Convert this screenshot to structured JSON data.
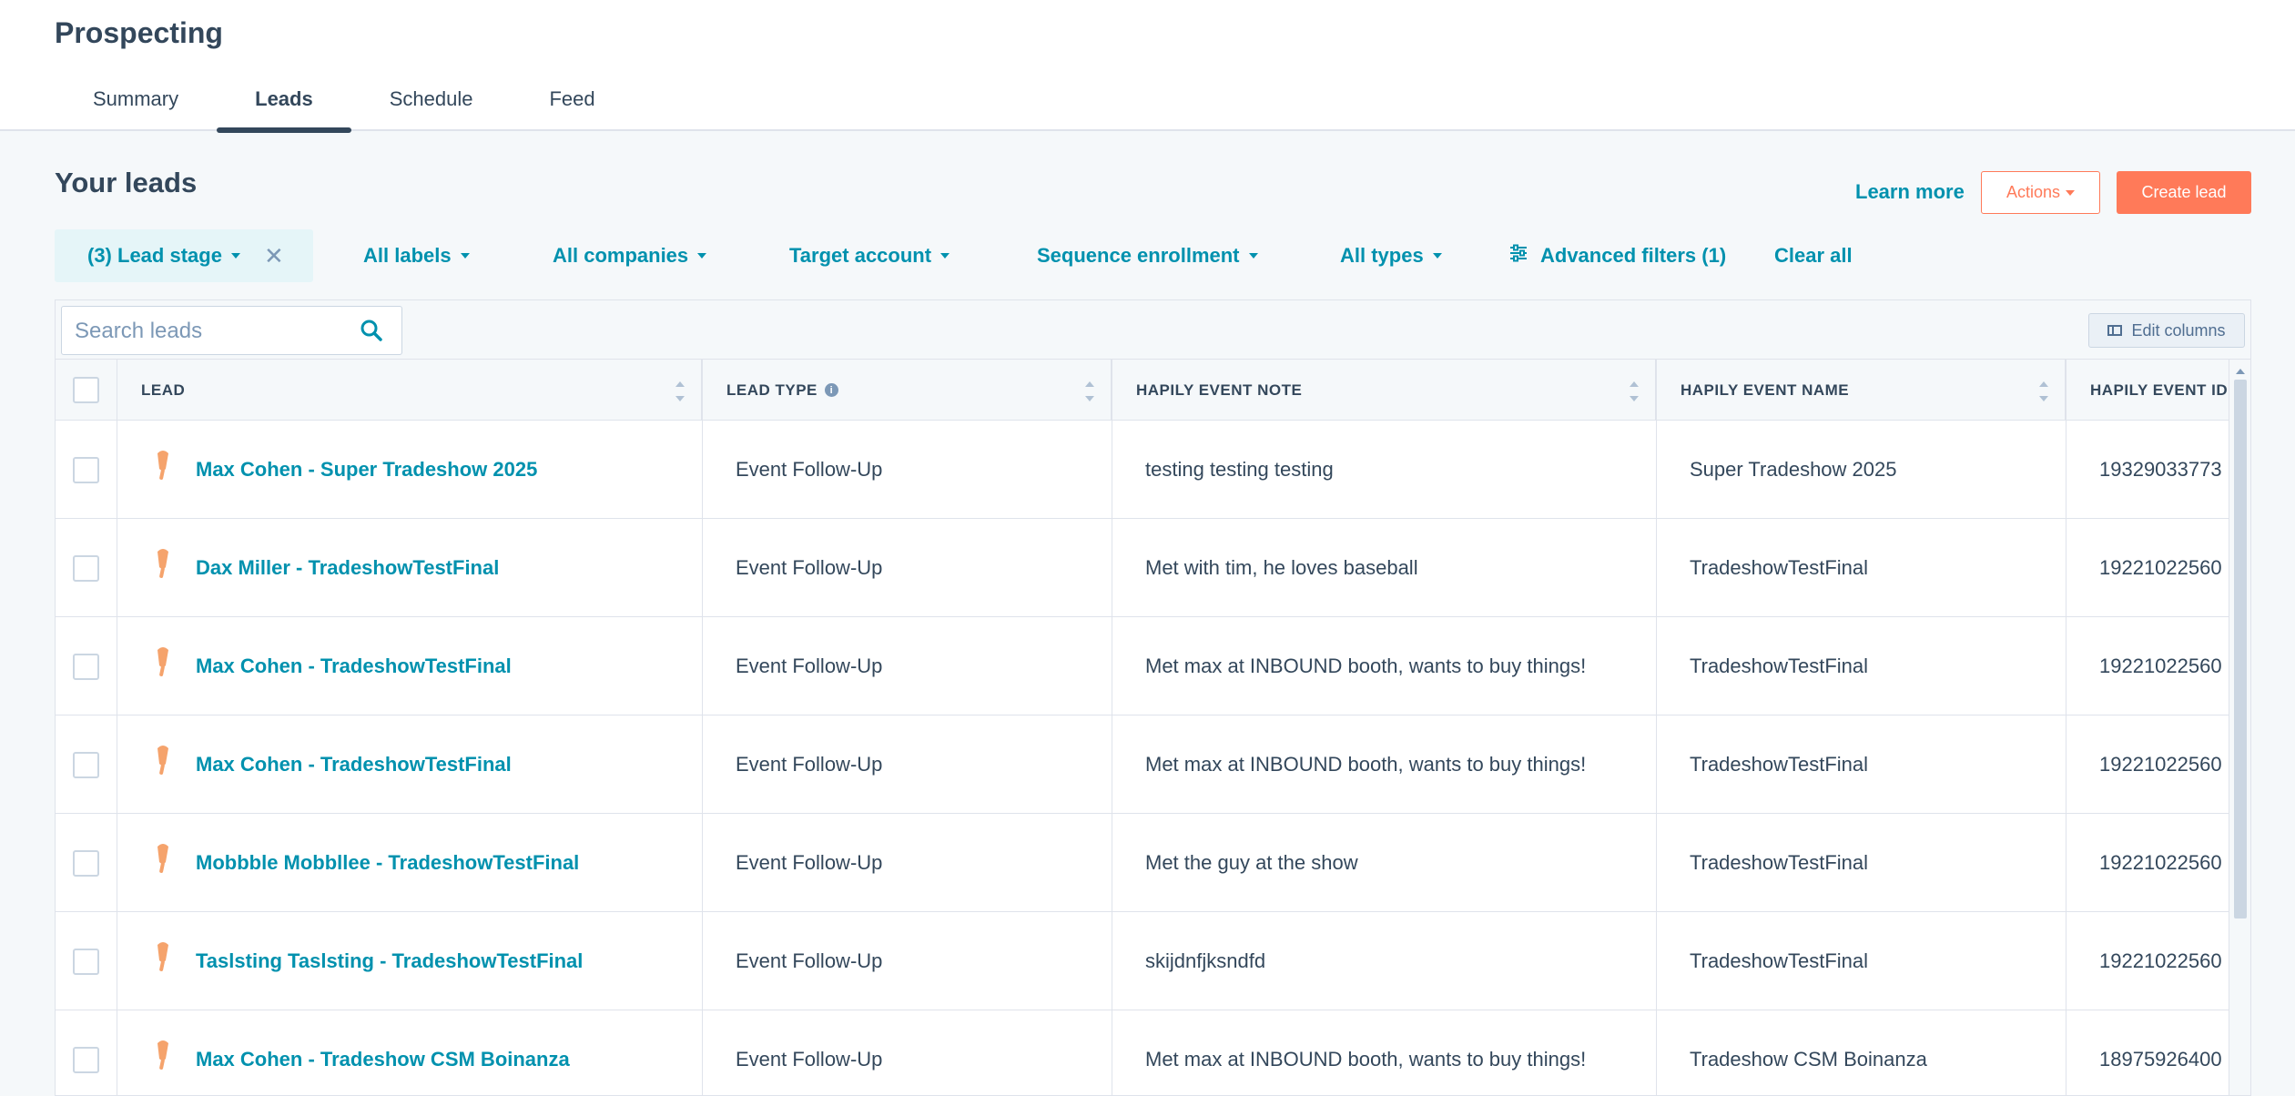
{
  "app": {
    "title": "Prospecting"
  },
  "tabs": [
    {
      "label": "Summary"
    },
    {
      "label": "Leads",
      "active": true
    },
    {
      "label": "Schedule"
    },
    {
      "label": "Feed"
    }
  ],
  "section": {
    "title": "Your leads",
    "learn_more": "Learn more",
    "actions_label": "Actions",
    "create_label": "Create lead"
  },
  "filters": {
    "lead_stage": "(3) Lead stage",
    "labels": "All labels",
    "companies": "All companies",
    "target_account": "Target account",
    "sequence": "Sequence enrollment",
    "types": "All types",
    "advanced": "Advanced filters (1)",
    "clear": "Clear all"
  },
  "search": {
    "placeholder": "Search leads"
  },
  "edit_columns": "Edit columns",
  "columns": {
    "lead": "LEAD",
    "lead_type": "LEAD TYPE",
    "event_note": "HAPILY EVENT NOTE",
    "event_name": "HAPILY EVENT NAME",
    "event_id": "HAPILY EVENT ID"
  },
  "rows": [
    {
      "lead": "Max Cohen - Super Tradeshow 2025",
      "type": "Event Follow-Up",
      "note": "testing testing testing",
      "event": "Super Tradeshow 2025",
      "id": "19329033773"
    },
    {
      "lead": "Dax Miller - TradeshowTestFinal",
      "type": "Event Follow-Up",
      "note": "Met with tim, he loves baseball",
      "event": "TradeshowTestFinal",
      "id": "19221022560"
    },
    {
      "lead": "Max Cohen - TradeshowTestFinal",
      "type": "Event Follow-Up",
      "note": "Met max at INBOUND booth, wants to buy things!",
      "event": "TradeshowTestFinal",
      "id": "19221022560"
    },
    {
      "lead": "Max Cohen - TradeshowTestFinal",
      "type": "Event Follow-Up",
      "note": "Met max at INBOUND booth, wants to buy things!",
      "event": "TradeshowTestFinal",
      "id": "19221022560"
    },
    {
      "lead": "Mobbble Mobbllee - TradeshowTestFinal",
      "type": "Event Follow-Up",
      "note": "Met the guy at the show",
      "event": "TradeshowTestFinal",
      "id": "19221022560"
    },
    {
      "lead": "Taslsting Taslsting - TradeshowTestFinal",
      "type": "Event Follow-Up",
      "note": "skijdnfjksndfd",
      "event": "TradeshowTestFinal",
      "id": "19221022560"
    },
    {
      "lead": "Max Cohen - Tradeshow CSM Boinanza",
      "type": "Event Follow-Up",
      "note": "Met max at INBOUND booth, wants to buy things!",
      "event": "Tradeshow CSM Boinanza",
      "id": "18975926400"
    }
  ],
  "colors": {
    "accent": "#0091ae",
    "primary_button": "#ff7a59",
    "text": "#33475b",
    "lead_icon": "#f5a36c"
  },
  "icons": {
    "search": "search-icon",
    "lead_type": "popsicle-icon",
    "filter": "sliders-icon",
    "close": "close-icon",
    "edit_columns": "columns-icon"
  }
}
